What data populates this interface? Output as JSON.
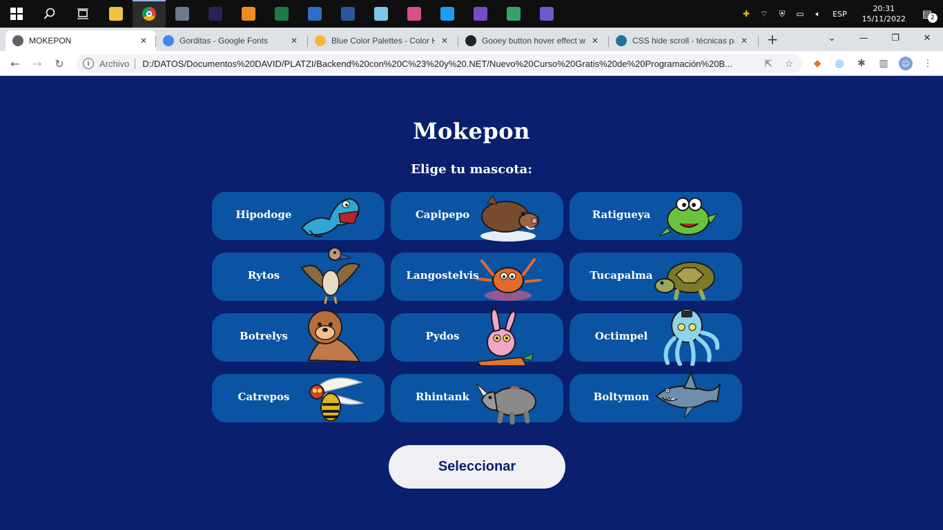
{
  "taskbar": {
    "apps": [
      {
        "name": "start",
        "icon": "windows-logo"
      },
      {
        "name": "search",
        "icon": "search-icon"
      },
      {
        "name": "task-view",
        "icon": "task-view-icon"
      },
      {
        "name": "file-explorer",
        "icon": "folder-icon",
        "color": "#f2c244"
      },
      {
        "name": "chrome",
        "icon": "chrome-icon",
        "color": "#4285f4",
        "active": true
      },
      {
        "name": "app-settings",
        "icon": "app-icon",
        "color": "#6c7a89"
      },
      {
        "name": "app-eclipse",
        "icon": "eclipse-icon",
        "color": "#2c2255"
      },
      {
        "name": "sublime",
        "icon": "sublime-icon",
        "color": "#f08b23"
      },
      {
        "name": "excel",
        "icon": "excel-icon",
        "color": "#1d7a45"
      },
      {
        "name": "remote",
        "icon": "remote-icon",
        "color": "#2f6cc4"
      },
      {
        "name": "word",
        "icon": "word-icon",
        "color": "#2b579a"
      },
      {
        "name": "app-crystal",
        "icon": "crystal-icon",
        "color": "#7cc7e8"
      },
      {
        "name": "app-games",
        "icon": "games-icon",
        "color": "#d94f8a"
      },
      {
        "name": "vscode",
        "icon": "vscode-icon",
        "color": "#1f9cf0"
      },
      {
        "name": "visual-studio",
        "icon": "visual-studio-icon",
        "color": "#7b4bc4"
      },
      {
        "name": "app-tool",
        "icon": "tool-icon",
        "color": "#38a169"
      },
      {
        "name": "app-infinity",
        "icon": "infinity-icon",
        "color": "#6a5acd"
      }
    ],
    "tray": {
      "language": "ESP",
      "time": "20:31",
      "date": "15/11/2022",
      "notification_count": "2"
    }
  },
  "browser": {
    "tabs": [
      {
        "title": "MOKEPON",
        "icon": "globe-icon",
        "color": "#5f6368"
      },
      {
        "title": "Gorditas - Google Fonts",
        "icon": "google-fonts-icon",
        "color": "#4285f4"
      },
      {
        "title": "Blue Color Palettes - Color Hu",
        "icon": "color-hunt-icon",
        "color": "#f7b733"
      },
      {
        "title": "Gooey button hover effect w",
        "icon": "codepen-icon",
        "color": "#222222"
      },
      {
        "title": "CSS hide scroll - técnicas par",
        "icon": "wordpress-icon",
        "color": "#21759b"
      }
    ],
    "address": {
      "scheme": "Archivo",
      "url": "D:/DATOS/Documentos%20DAVID/PLATZI/Backend%20con%20C%23%20y%20.NET/Nuevo%20Curso%20Gratis%20de%20Programación%20B..."
    }
  },
  "page": {
    "title": "Mokepon",
    "subtitle": "Elige tu mascota:",
    "pets": [
      {
        "name": "Hipodoge",
        "icon": "blue-lizard-icon",
        "color": "#2fa6d6"
      },
      {
        "name": "Capipepo",
        "icon": "boar-icon",
        "color": "#7a4a2e"
      },
      {
        "name": "Ratigueya",
        "icon": "green-creature-icon",
        "color": "#6cc13c"
      },
      {
        "name": "Rytos",
        "icon": "vulture-icon",
        "color": "#8a6a3e"
      },
      {
        "name": "Langostelvis",
        "icon": "lobster-icon",
        "color": "#e26a2c"
      },
      {
        "name": "Tucapalma",
        "icon": "turtle-icon",
        "color": "#7a7a2a"
      },
      {
        "name": "Botrelys",
        "icon": "seal-icon",
        "color": "#b86e3a"
      },
      {
        "name": "Pydos",
        "icon": "rabbit-icon",
        "color": "#f3a6c8"
      },
      {
        "name": "Octimpel",
        "icon": "octopus-icon",
        "color": "#8fd3ea"
      },
      {
        "name": "Catrepos",
        "icon": "wasp-icon",
        "color": "#e0b423"
      },
      {
        "name": "Rhintank",
        "icon": "rhino-icon",
        "color": "#8a8a8a"
      },
      {
        "name": "Boltymon",
        "icon": "shark-icon",
        "color": "#6f8faa"
      }
    ],
    "select_button": "Seleccionar"
  }
}
